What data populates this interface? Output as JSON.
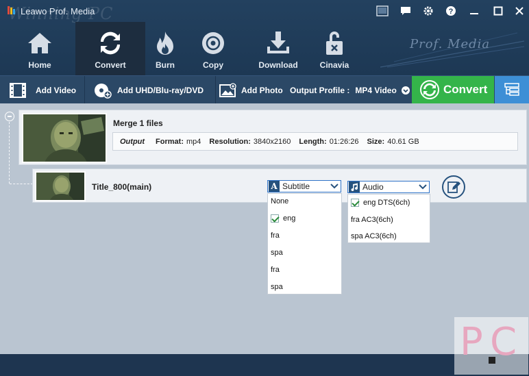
{
  "window": {
    "title": "Leawo Prof. Media",
    "watermark": "Winning PC"
  },
  "nav": {
    "tabs": [
      {
        "label": "Home",
        "icon": "home-icon"
      },
      {
        "label": "Convert",
        "icon": "convert-icon",
        "active": true
      },
      {
        "label": "Burn",
        "icon": "flame-icon"
      },
      {
        "label": "Copy",
        "icon": "disc-icon"
      },
      {
        "label": "Download",
        "icon": "download-icon"
      },
      {
        "label": "Cinavia",
        "icon": "lock-icon"
      }
    ],
    "brand": "Prof. Media"
  },
  "toolbar": {
    "add_video": "Add Video",
    "add_uhd": "Add UHD/Blu-ray/DVD",
    "add_photo": "Add Photo",
    "output_profile_label": "Output Profile :",
    "output_profile_value": "MP4 Video",
    "convert_label": "Convert"
  },
  "colors": {
    "accent_green": "#34b44a",
    "accent_blue": "#3d8fd6",
    "nav_bg": "#23415f"
  },
  "merge": {
    "title": "Merge 1 files",
    "output_label": "Output",
    "format_label": "Format:",
    "format_value": "mp4",
    "resolution_label": "Resolution:",
    "resolution_value": "3840x2160",
    "length_label": "Length:",
    "length_value": "01:26:26",
    "size_label": "Size:",
    "size_value": "40.61 GB"
  },
  "title_item": {
    "name": "Title_800(main)"
  },
  "subtitle": {
    "selected": "Subtitle",
    "options": [
      {
        "label": "None",
        "checked": false
      },
      {
        "label": "eng",
        "checked": true
      },
      {
        "label": "fra",
        "checked": false
      },
      {
        "label": "spa",
        "checked": false
      },
      {
        "label": "fra",
        "checked": false
      },
      {
        "label": "spa",
        "checked": false
      }
    ]
  },
  "audio": {
    "selected": "Audio",
    "options": [
      {
        "label": "eng DTS(6ch)",
        "checked": true
      },
      {
        "label": "fra AC3(6ch)",
        "checked": false
      },
      {
        "label": "spa AC3(6ch)",
        "checked": false
      }
    ]
  },
  "watermark_logo": {
    "p": "P",
    "c": "C"
  }
}
